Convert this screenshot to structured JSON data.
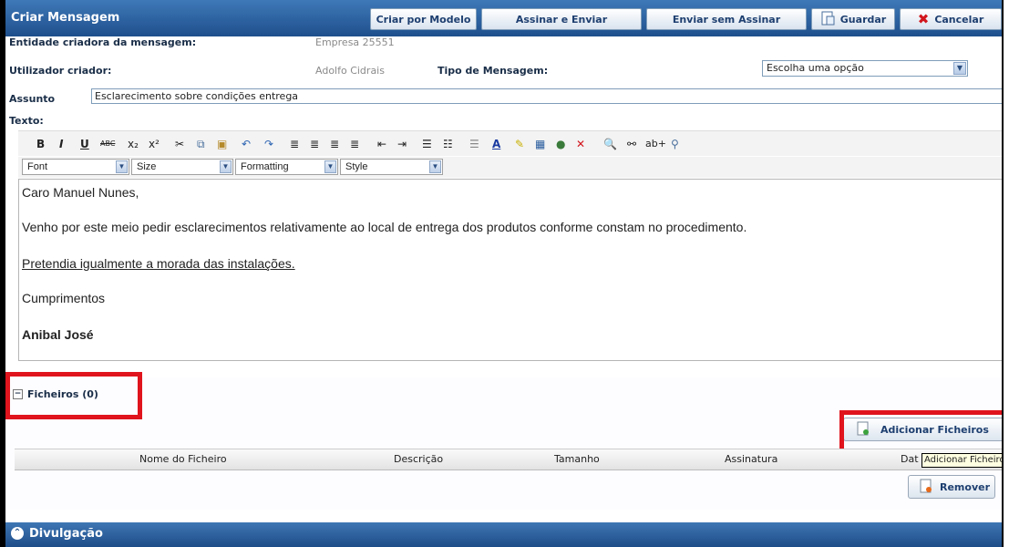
{
  "window": {
    "title": "Criar Mensagem"
  },
  "toolbar": {
    "criar_modelo": "Criar por Modelo",
    "assinar_enviar": "Assinar e Enviar",
    "enviar_sem_assinar": "Enviar sem Assinar",
    "guardar": "Guardar",
    "cancelar": "Cancelar"
  },
  "form": {
    "entidade_label": "Entidade criadora da mensagem:",
    "entidade_value": "Empresa 25551",
    "utilizador_label": "Utilizador criador:",
    "utilizador_value": "Adolfo Cidrais",
    "tipo_label": "Tipo de Mensagem:",
    "tipo_value": "Escolha uma opção",
    "assunto_label": "Assunto",
    "assunto_value": "Esclarecimento sobre condições entrega",
    "texto_label": "Texto:"
  },
  "editor": {
    "toolbar_row2": {
      "font": "Font",
      "size": "Size",
      "formatting": "Formatting",
      "style": "Style"
    },
    "content": {
      "line1": "Caro Manuel Nunes,",
      "line2": "Venho por este meio pedir esclarecimentos relativamente ao local de entrega dos produtos conforme constam no procedimento.",
      "line3": "Pretendia igualmente a morada das instalações.",
      "line4": "Cumprimentos",
      "line5": "Anibal José"
    }
  },
  "files": {
    "header": "Ficheiros (0)",
    "add_button": "Adicionar Ficheiros",
    "remove_button": "Remover",
    "tooltip": "Adicionar Ficheiros",
    "columns": {
      "nome": "Nome do Ficheiro",
      "descricao": "Descrição",
      "tamanho": "Tamanho",
      "assinatura": "Assinatura",
      "data": "Dat"
    }
  },
  "footer": {
    "section": "Divulgação"
  },
  "colors": {
    "header_blue": "#2b5f9e",
    "highlight_red": "#e0141d"
  }
}
